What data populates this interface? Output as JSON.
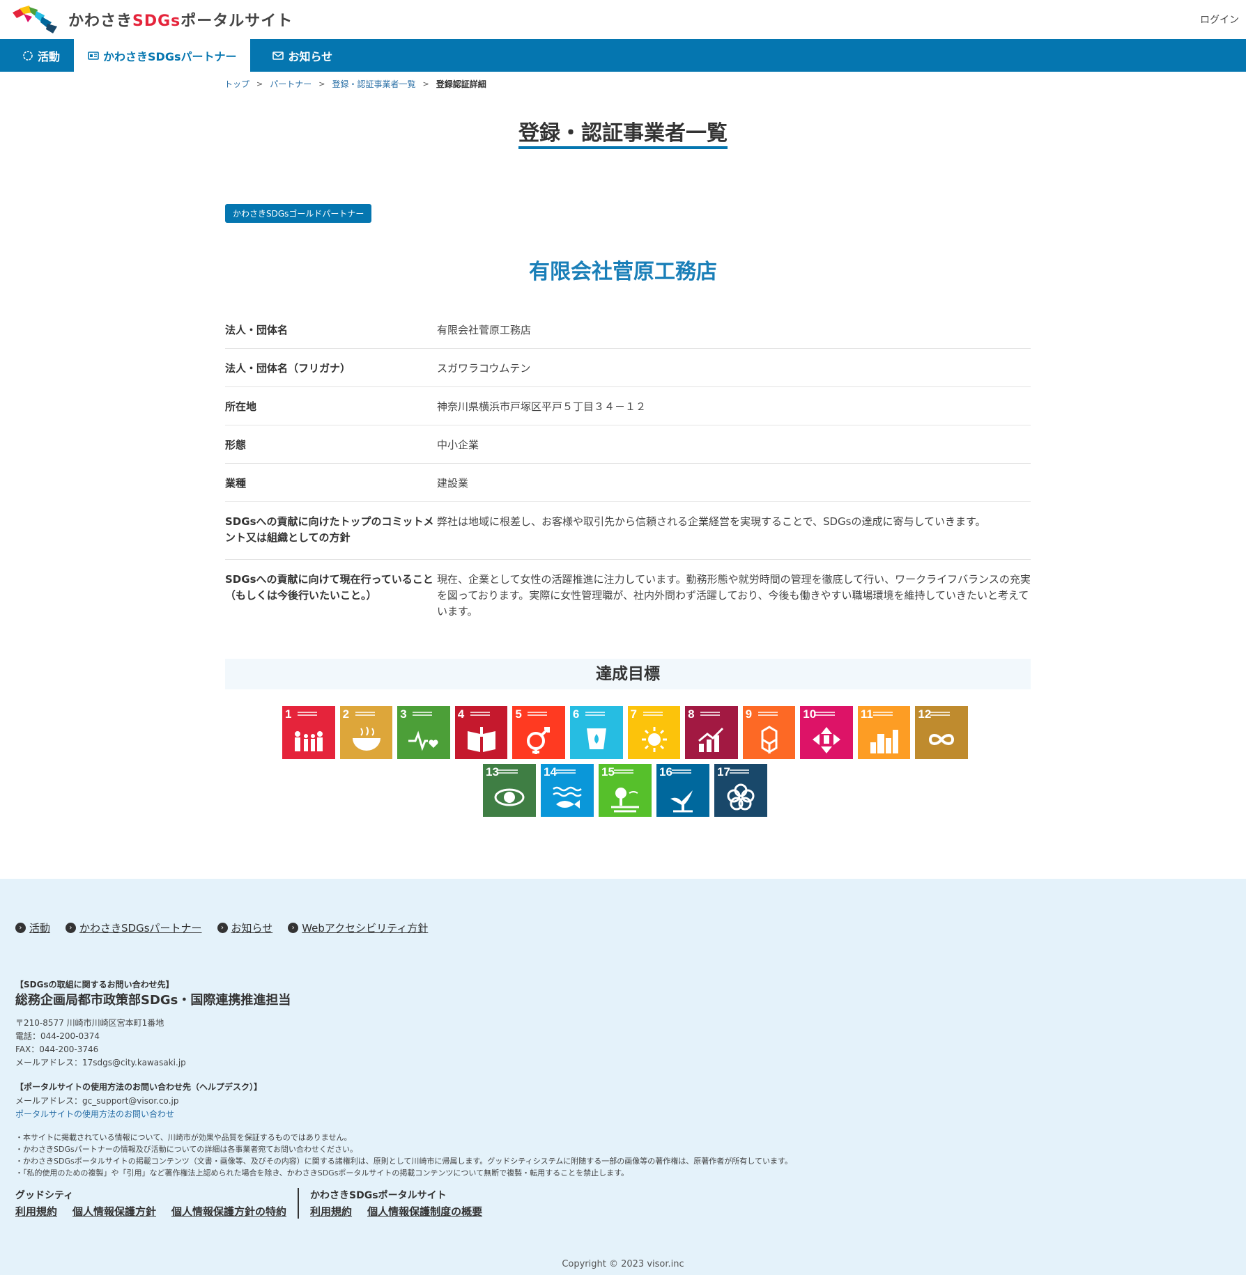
{
  "header": {
    "logo_text_pre": "かわさき",
    "logo_text_sdgs": "SDGs",
    "logo_text_post": "ポータルサイト",
    "login": "ログイン"
  },
  "nav": [
    {
      "label": "活動",
      "icon": "activity-icon"
    },
    {
      "label": "かわさきSDGsパートナー",
      "icon": "id-card-icon"
    },
    {
      "label": "お知らせ",
      "icon": "mail-icon"
    }
  ],
  "breadcrumb": [
    "トップ",
    "パートナー",
    "登録・認証事業者一覧",
    "登録認証詳細"
  ],
  "page_title": "登録・認証事業者一覧",
  "badge": "かわさきSDGsゴールドパートナー",
  "company_name": "有限会社菅原工務店",
  "info": [
    {
      "key": "法人・団体名",
      "value": "有限会社菅原工務店"
    },
    {
      "key": "法人・団体名（フリガナ）",
      "value": "スガワラコウムテン"
    },
    {
      "key": "所在地",
      "value": "神奈川県横浜市戸塚区平戸５丁目３４－１２"
    },
    {
      "key": "形態",
      "value": "中小企業"
    },
    {
      "key": "業種",
      "value": "建設業"
    },
    {
      "key": "SDGsへの貢献に向けたトップのコミットメント又は組織としての方針",
      "value": "弊社は地域に根差し、お客様や取引先から信頼される企業経営を実現することで、SDGsの達成に寄与していきます。"
    },
    {
      "key": "SDGsへの貢献に向けて現在行っていること（もしくは今後行いたいこと。）",
      "value": "現在、企業として女性の活躍推進に注力しています。勤務形態や就労時間の管理を徹底して行い、ワークライフバランスの充実を図っております。実際に女性管理職が、社内外問わず活躍しており、今後も働きやすい職場環境を維持していきたいと考えています。"
    }
  ],
  "goals_heading": "達成目標",
  "goals": [
    {
      "num": "1",
      "color": "#e5243b"
    },
    {
      "num": "2",
      "color": "#dda63a"
    },
    {
      "num": "3",
      "color": "#4c9f38"
    },
    {
      "num": "4",
      "color": "#c5192d"
    },
    {
      "num": "5",
      "color": "#ff3a21"
    },
    {
      "num": "6",
      "color": "#26bde2"
    },
    {
      "num": "7",
      "color": "#fcc30b"
    },
    {
      "num": "8",
      "color": "#a21942"
    },
    {
      "num": "9",
      "color": "#fd6925"
    },
    {
      "num": "10",
      "color": "#dd1367"
    },
    {
      "num": "11",
      "color": "#fd9d24"
    },
    {
      "num": "12",
      "color": "#bf8b2e"
    },
    {
      "num": "13",
      "color": "#3f7e44"
    },
    {
      "num": "14",
      "color": "#0a97d9"
    },
    {
      "num": "15",
      "color": "#56c02b"
    },
    {
      "num": "16",
      "color": "#00689d"
    },
    {
      "num": "17",
      "color": "#19486a"
    }
  ],
  "footer": {
    "links": [
      "活動",
      "かわさきSDGsパートナー",
      "お知らせ",
      "Webアクセシビリティ方針"
    ],
    "contact_head": "【SDGsの取組に関するお問い合わせ先】",
    "dept": "総務企画局都市政策部SDGs・国際連携推進担当",
    "address": [
      "〒210-8577 川崎市川崎区宮本町1番地",
      "電話：044-200-0374",
      "FAX：044-200-3746",
      "メールアドレス：17sdgs@city.kawasaki.jp"
    ],
    "help_head": "【ポータルサイトの使用方法のお問い合わせ先（ヘルプデスク）】",
    "help_email": "メールアドレス：gc_support@visor.co.jp",
    "help_link": "ポータルサイトの使用方法のお問い合わせ",
    "notes": [
      "・本サイトに掲載されている情報について、川崎市が効果や品質を保証するものではありません。",
      "・かわさきSDGsパートナーの情報及び活動についての詳細は各事業者宛てお問い合わせください。",
      "・かわさきSDGsポータルサイトの掲載コンテンツ（文書・画像等、及びその内容）に関する諸権利は、原則として川崎市に帰属します。グッドシティシステムに附随する一部の画像等の著作権は、原著作者が所有しています。",
      "・「私的使用のための複製」や「引用」など著作権法上認められた場合を除き、かわさきSDGsポータルサイトの掲載コンテンツについて無断で複製・転用することを禁止します。"
    ],
    "legal_groups": [
      {
        "title": "グッドシティ",
        "links": [
          "利用規約",
          "個人情報保護方針",
          "個人情報保護方針の特約"
        ]
      },
      {
        "title": "かわさきSDGsポータルサイト",
        "links": [
          "利用規約",
          "個人情報保護制度の概要"
        ]
      }
    ],
    "copyright": "Copyright © 2023 visor.inc"
  }
}
